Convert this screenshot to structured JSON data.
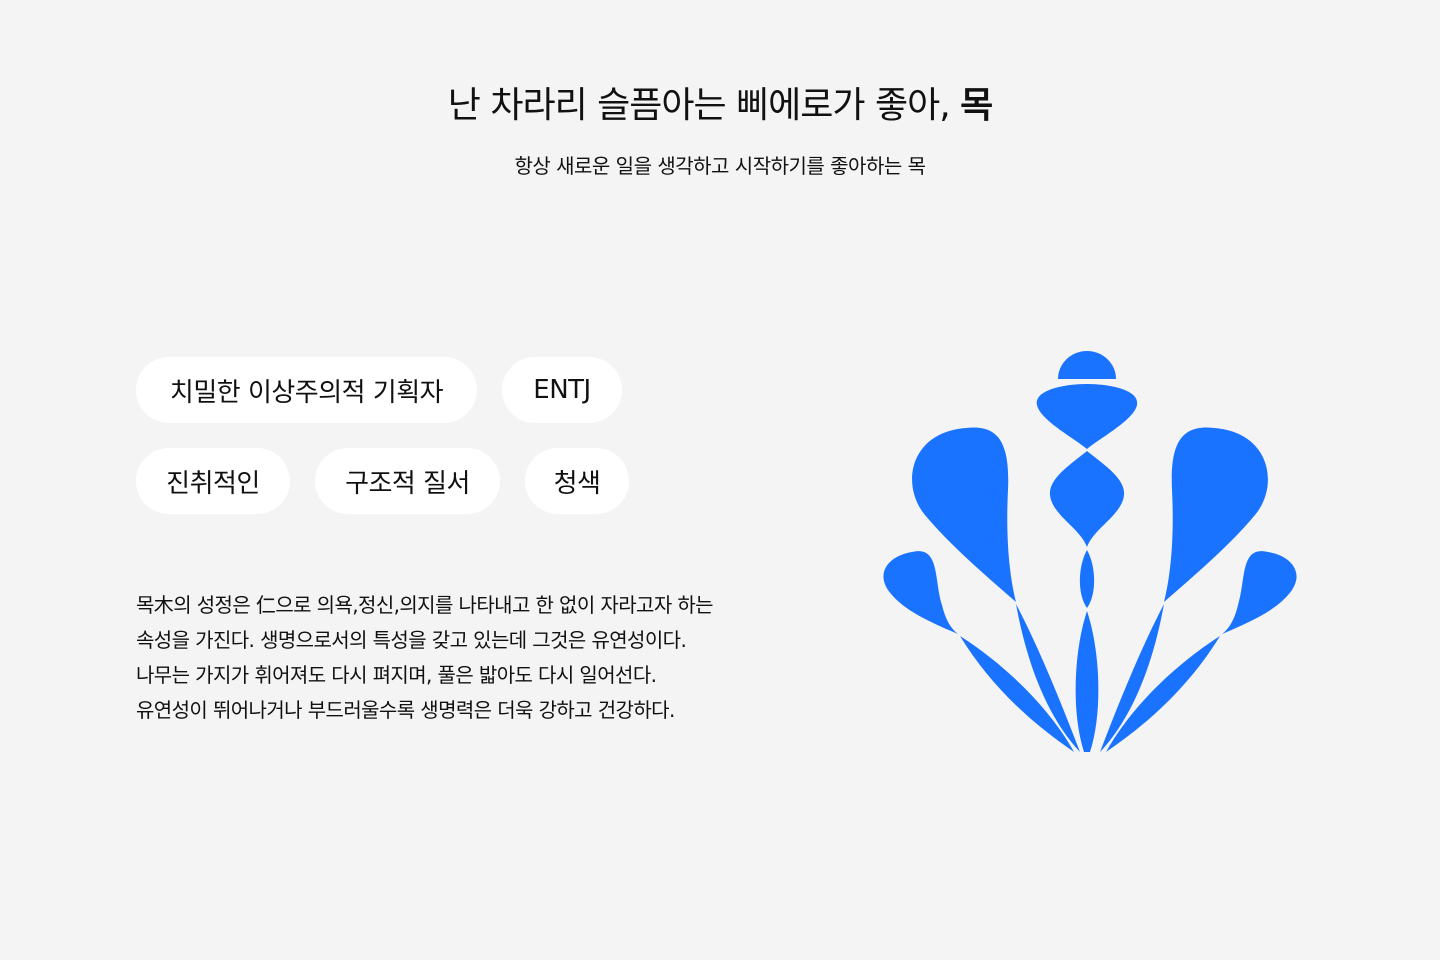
{
  "header": {
    "title_prefix": "난 차라리 슬픔아는 삐에로가 좋아, ",
    "title_bold": "목",
    "subtitle": "항상 새로운 일을 생각하고 시작하기를 좋아하는 목"
  },
  "tags": [
    "치밀한 이상주의적 기획자",
    "ENTJ",
    "진취적인",
    "구조적 질서",
    "청색"
  ],
  "description": [
    "목木의 성정은 仁으로 의욕,정신,의지를 나타내고 한 없이 자라고자 하는",
    "속성을 가진다. 생명으로서의 특성을 갖고 있는데 그것은 유연성이다.",
    "나무는 가지가 휘어져도 다시 펴지며, 풀은 밟아도 다시 일어선다.",
    "유연성이 뛰어나거나 부드러울수록 생명력은 더욱 강하고 건강하다."
  ],
  "colors": {
    "accent": "#1A73FF",
    "background": "#F4F4F4",
    "tag_background": "#FFFFFF"
  },
  "emblem": {
    "icon": "wood-element-flower-icon"
  }
}
